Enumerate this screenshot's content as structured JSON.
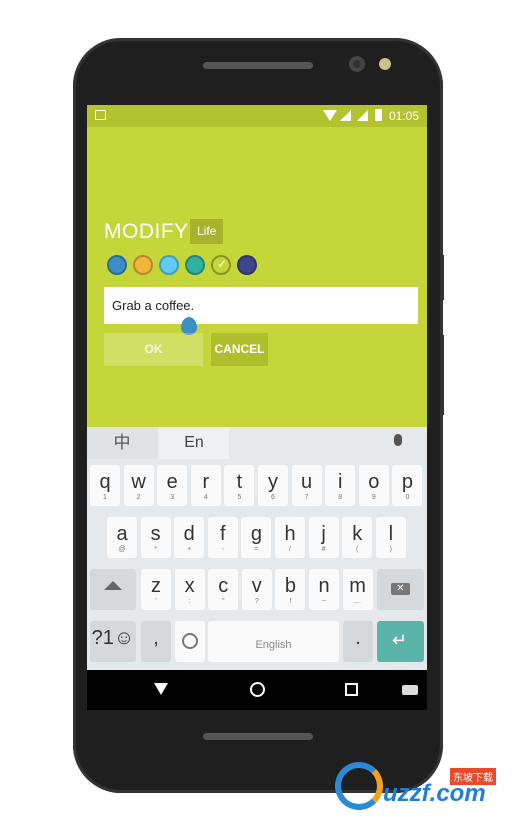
{
  "status_bar": {
    "time": "01:05"
  },
  "app": {
    "title": "MODIFY",
    "category": "Life",
    "input_value": "Grab a coffee.",
    "ok_label": "OK",
    "cancel_label": "CANCEL",
    "colors": [
      "#3a8fc7",
      "#f3b43a",
      "#5fcdf5",
      "#2fb3a0",
      "#c5d63a",
      "#3d4689"
    ],
    "selected_color_index": 4
  },
  "keyboard": {
    "lang_cn": "中",
    "lang_en": "En",
    "row1": [
      [
        "q",
        "1"
      ],
      [
        "w",
        "2"
      ],
      [
        "e",
        "3"
      ],
      [
        "r",
        "4"
      ],
      [
        "t",
        "5"
      ],
      [
        "y",
        "6"
      ],
      [
        "u",
        "7"
      ],
      [
        "i",
        "8"
      ],
      [
        "o",
        "9"
      ],
      [
        "p",
        "0"
      ]
    ],
    "row2": [
      [
        "a",
        "@"
      ],
      [
        "s",
        "*"
      ],
      [
        "d",
        "+"
      ],
      [
        "f",
        "-"
      ],
      [
        "g",
        "="
      ],
      [
        "h",
        "/"
      ],
      [
        "j",
        "#"
      ],
      [
        "k",
        "("
      ],
      [
        "l",
        ")"
      ]
    ],
    "row3": [
      [
        "z",
        "'"
      ],
      [
        "x",
        ":"
      ],
      [
        "c",
        "\""
      ],
      [
        "v",
        "?"
      ],
      [
        "b",
        "!"
      ],
      [
        "n",
        "~"
      ],
      [
        "m",
        "…"
      ]
    ],
    "symbols_label": "?1☺",
    "comma": ",",
    "space_label": "English",
    "period": ".",
    "enter_color": "#5ab5a8"
  },
  "watermark": {
    "text": "东坡下载",
    "site": "uzzf.com"
  }
}
